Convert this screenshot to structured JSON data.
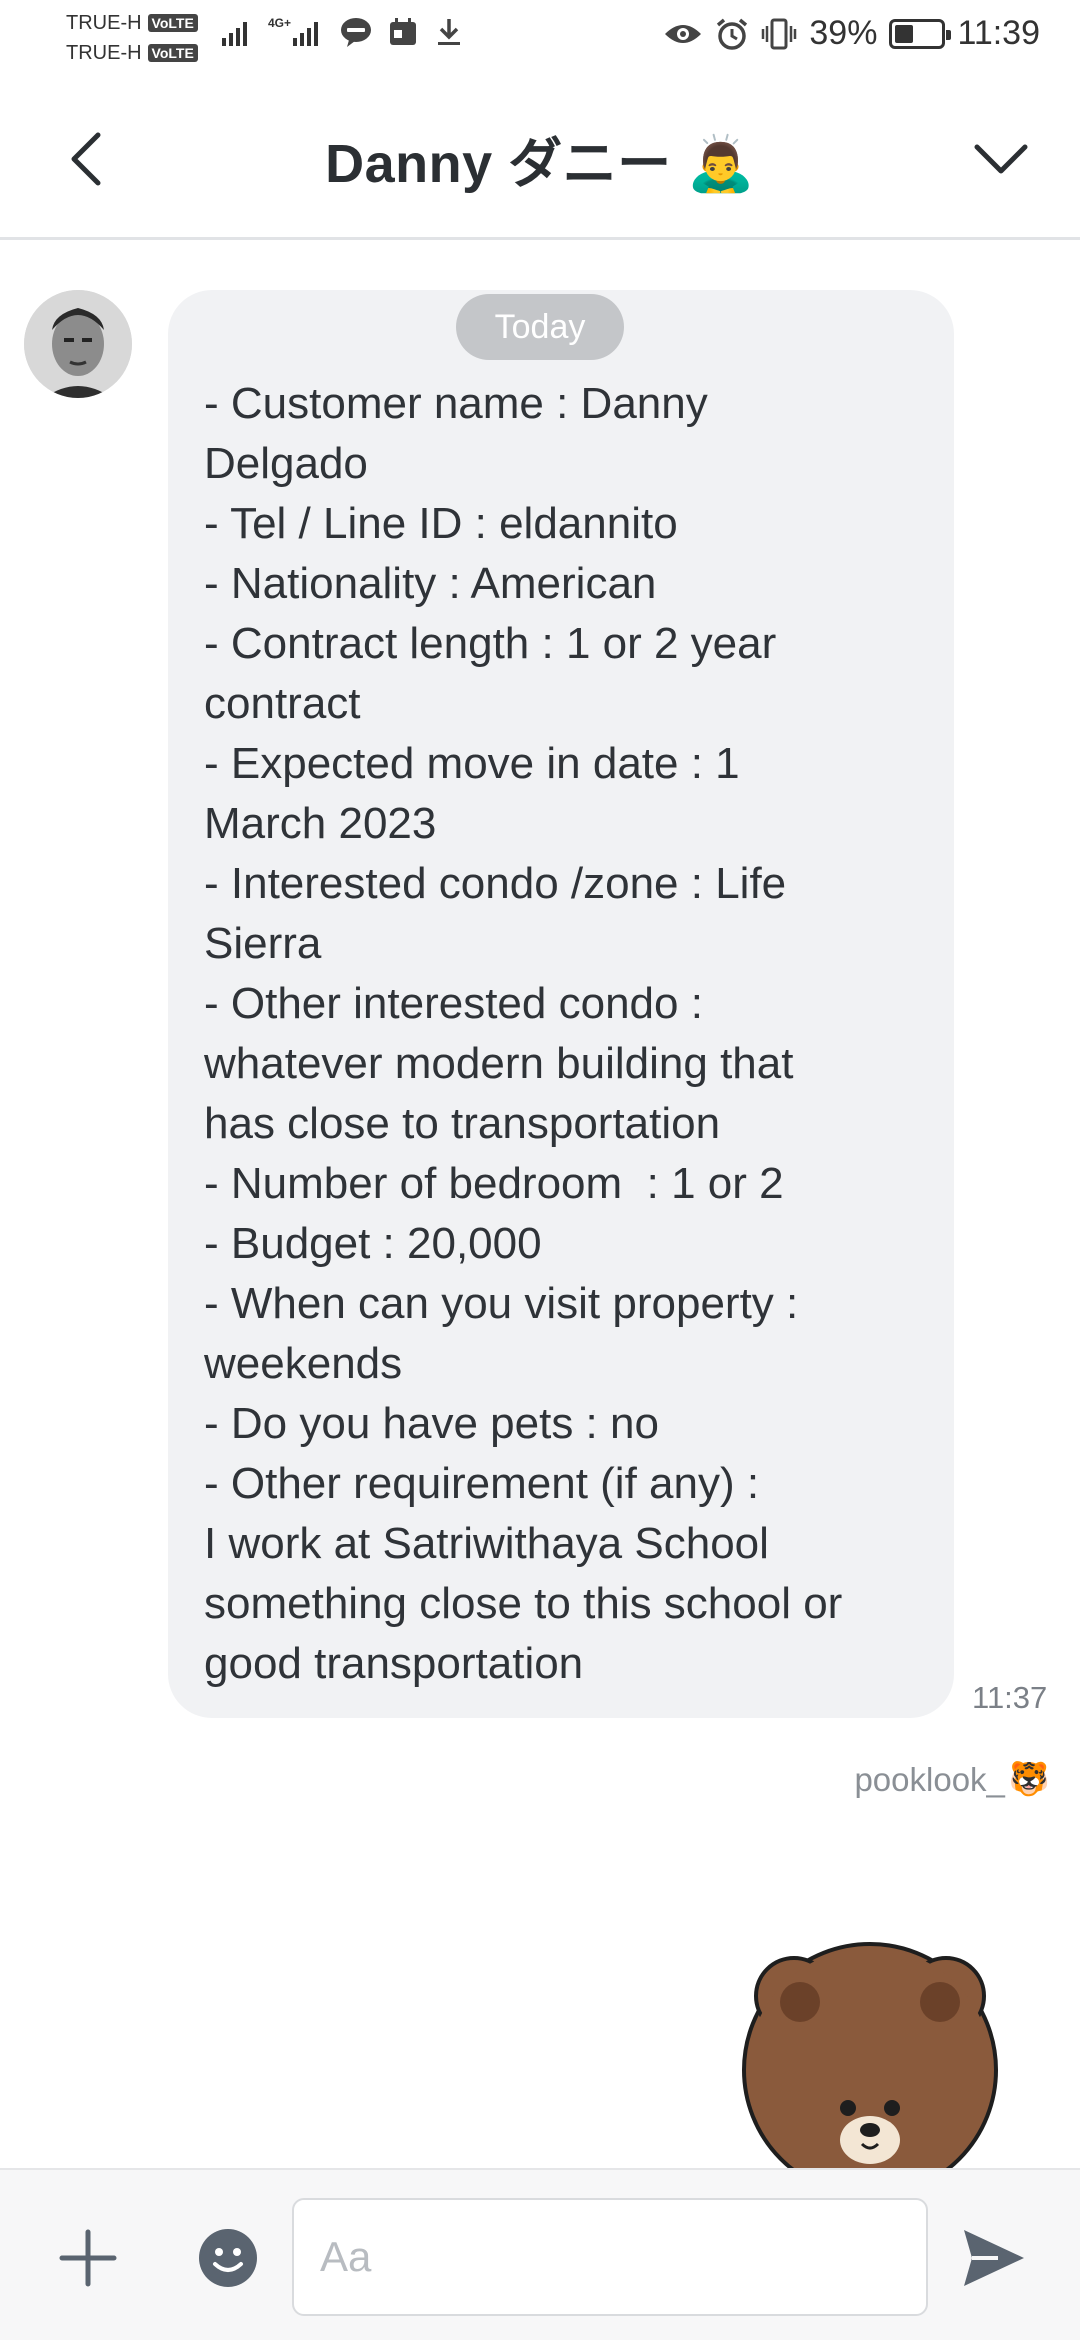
{
  "status_bar": {
    "carrier_1": "TRUE-H",
    "carrier_2": "TRUE-H",
    "volte_badge": "VoLTE",
    "network_badge": "4G+",
    "battery_percent_text": "39%",
    "battery_level": 0.39,
    "time": "11:39"
  },
  "header": {
    "title": "Danny ダニー 🙇‍♂️"
  },
  "chat": {
    "date_chip": "Today",
    "message_lines": [
      "- Customer name : Danny",
      "Delgado",
      "- Tel / Line ID : eldannito",
      "- Nationality : American",
      "- Contract length : 1 or 2 year",
      "contract",
      "- Expected move in date : 1",
      "March 2023",
      "- Interested condo /zone : Life",
      "Sierra",
      "- Other interested condo :",
      "whatever modern building that",
      "has close to transportation",
      "- Number of bedroom  : 1 or 2",
      "- Budget : 20,000",
      "- When can you visit property :",
      "weekends",
      "- Do you have pets : no",
      "- Other requirement (if any) :",
      "I work at Satriwithaya School",
      "something close to this school or",
      "good transportation"
    ],
    "message_time": "11:37",
    "sender_name": "pooklook_",
    "sender_emoji": "🐯"
  },
  "input_bar": {
    "placeholder": "Aa"
  },
  "icons": {
    "back": "chevron-left-icon",
    "collapse": "chevron-down-icon",
    "add": "plus-icon",
    "emoji": "smiley-icon",
    "send": "send-icon"
  },
  "colors": {
    "bubble": "#f1f2f4",
    "date_chip": "#c4c6c9",
    "icon": "#5a6470"
  }
}
